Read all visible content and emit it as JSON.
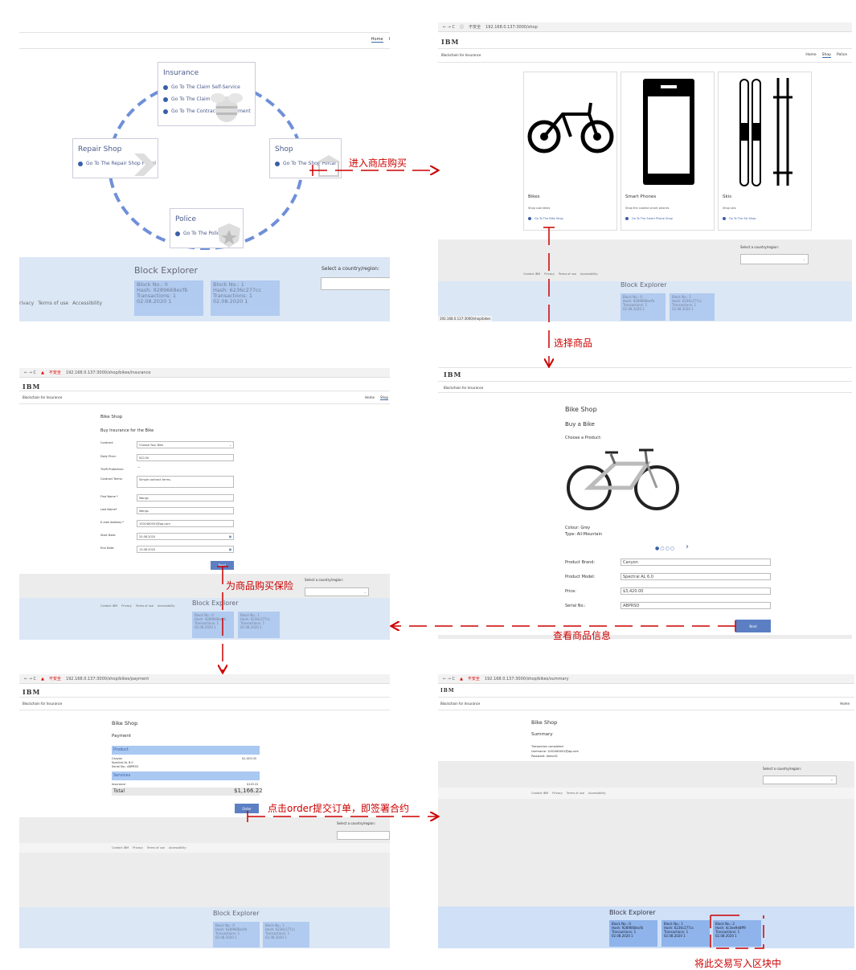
{
  "panel1": {
    "nav_home": "Home",
    "nav_dot": "I",
    "insurance": {
      "title": "Insurance",
      "links": [
        "Go To The Claim Self-Service",
        "Go To The Claim Processing",
        "Go To The Contract Management"
      ]
    },
    "repair": {
      "title": "Repair Shop",
      "link": "Go To The Repair Shop Portal"
    },
    "shop": {
      "title": "Shop",
      "link": "Go To The Shop Portal"
    },
    "police": {
      "title": "Police",
      "link": "Go To The Police Portal"
    },
    "block_explorer": "Block Explorer",
    "select_country": "Select a country/region:",
    "footer": [
      "rivacy",
      "Terms of use",
      "Accessibility"
    ],
    "blocks": [
      "Block No.: 0\nHash: 9289668ecfb\nTransactions: 1\n02.08.2020 1",
      "Block No.: 1\nHash: 6236c277cc\nTransactions: 1\n02.08.2020 1"
    ]
  },
  "panel2": {
    "url": "192.168.0.137:3000/shop",
    "not_secure": "不安全",
    "ibm": "IBM",
    "subtitle": "Blockchain for Insurance",
    "nav": [
      "Home",
      "Shop",
      "Police"
    ],
    "cards": [
      {
        "title": "Bikes",
        "desc": "Shop cool bikes",
        "link": "Go To The Bike Shop"
      },
      {
        "title": "Smart Phones",
        "desc": "Shop the coolest smart phones",
        "link": "Go To The Smart Phone Shop"
      },
      {
        "title": "Skis",
        "desc": "Shop skis",
        "link": "Go To The Ski Shop"
      }
    ],
    "select_country": "Select a country/region:",
    "footer": [
      "Contact IBM",
      "Privacy",
      "Terms of use",
      "Accessibility"
    ],
    "block_explorer": "Block Explorer",
    "status_url": "192.168.0.137:3000/shop/bikes",
    "blocks": [
      "Block No.: 0\nHash: 9289668ecfb\nTransactions: 1\n02.08.2020 1",
      "Block No.: 1\nHash: 6236c277cc\nTransactions: 1\n02.08.2020 1"
    ]
  },
  "panel3": {
    "ibm": "IBM",
    "subtitle": "Blockchain for Insurance",
    "shop_title": "Bike Shop",
    "heading": "Buy a Bike",
    "choose": "Choose a Product:",
    "colour": "Colour: Grey",
    "type": "Type: All-Mountain",
    "fields": [
      {
        "label": "Product Brand:",
        "value": "Canyon"
      },
      {
        "label": "Product Model:",
        "value": "Spectral AL 6.0"
      },
      {
        "label": "Price:",
        "value": "$3,420.00"
      },
      {
        "label": "Serial No.:",
        "value": "ABPRSO"
      }
    ],
    "next": "Next"
  },
  "panel4": {
    "url": "192.168.0.137:3000/shop/bikes/insurance",
    "not_secure": "不安全",
    "ibm": "IBM",
    "subtitle": "Blockchain for Insurance",
    "nav": [
      "Home",
      "Shop"
    ],
    "shop_title": "Bike Shop",
    "heading": "Buy Insurance for the Bike",
    "fields": [
      {
        "label": "Contract:",
        "value": "Choose Your Bike"
      },
      {
        "label": "Daily Price:",
        "value": "$20.50"
      },
      {
        "label": "Theft Protection:",
        "value": "—"
      },
      {
        "label": "Contract Terms:",
        "value": "Simple contract terms."
      },
      {
        "label": "First Name *",
        "value": "Wangs"
      },
      {
        "label": "Last Name*",
        "value": "Wangs"
      },
      {
        "label": "E-mail Address *",
        "value": "1002480001@qq.com"
      },
      {
        "label": "Start Date:",
        "value": "20.08.2020"
      },
      {
        "label": "End Date:",
        "value": "13.08.2020"
      }
    ],
    "next": "Next",
    "select_country": "Select a country/region:",
    "footer": [
      "Contact IBM",
      "Privacy",
      "Terms of use",
      "Accessibility"
    ],
    "block_explorer": "Block Explorer",
    "blocks": [
      "Block No.: 0\nHash: 9289668ecfb\nTransactions: 1\n02.08.2020 1",
      "Block No.: 1\nHash: 6236c277cc\nTransactions: 1\n02.08.2020 1"
    ]
  },
  "panel5": {
    "url": "192.168.0.137:3000/shop/bikes/payment",
    "not_secure": "不安全",
    "ibm": "IBM",
    "subtitle": "Blockchain for Insurance",
    "shop_title": "Bike Shop",
    "heading": "Payment",
    "product_header": "Product",
    "product_lines": [
      "Canyon",
      "Spectral AL 6.0",
      "Serial No.: ABPRSO"
    ],
    "product_price": "$1,023.00",
    "services_header": "Services",
    "insurance_label": "Insurance",
    "insurance_price": "$143.22",
    "total_label": "Total",
    "total_value": "$1,166.22",
    "order": "Order",
    "select_country": "Select a country/region:",
    "footer": [
      "Contact IBM",
      "Privacy",
      "Terms of use",
      "Accessibility"
    ],
    "block_explorer": "Block Explorer",
    "blocks": [
      "Block No.: 0\nHash: 9289668ecfb\nTransactions: 1\n02.08.2020 1",
      "Block No.: 1\nHash: 6236c277cc\nTransactions: 1\n02.08.2020 1"
    ]
  },
  "panel6": {
    "url": "192.168.0.137:3000/shop/bikes/summary",
    "not_secure": "不安全",
    "ibm": "IBM",
    "subtitle": "Blockchain for Insurance",
    "nav": [
      "Home"
    ],
    "shop_title": "Bike Shop",
    "heading": "Summary",
    "summary_lines": [
      "Transaction completed",
      "Username: 1002480001@qq.com",
      "Password: demo01"
    ],
    "select_country": "Select a country/region:",
    "footer": [
      "Contact IBM",
      "Privacy",
      "Terms of use",
      "Accessibility"
    ],
    "block_explorer": "Block Explorer",
    "blocks": [
      "Block No.: 0\nHash: 9289668ecfb\nTransactions: 1\n02.08.2020 1",
      "Block No.: 1\nHash: 6236c277cc\nTransactions: 1\n02.08.2020 1",
      "Block No.: 2\nHash: 4c3ee9e8ff9\nTransactions: 1\n02.08.2020 1"
    ]
  },
  "captions": {
    "enter_shop": "进入商店购买",
    "choose_product": "选择商品",
    "buy_insurance": "为商品购买保险",
    "view_info": "查看商品信息",
    "place_order": "点击order提交订单，即签署合约",
    "write_block": "将此交易写入区块中"
  },
  "colors": {
    "accent": "#5c7fc4",
    "annotation": "#cc0000",
    "block": "#aac6ee",
    "explorer_bg": "#dbe7f5"
  }
}
